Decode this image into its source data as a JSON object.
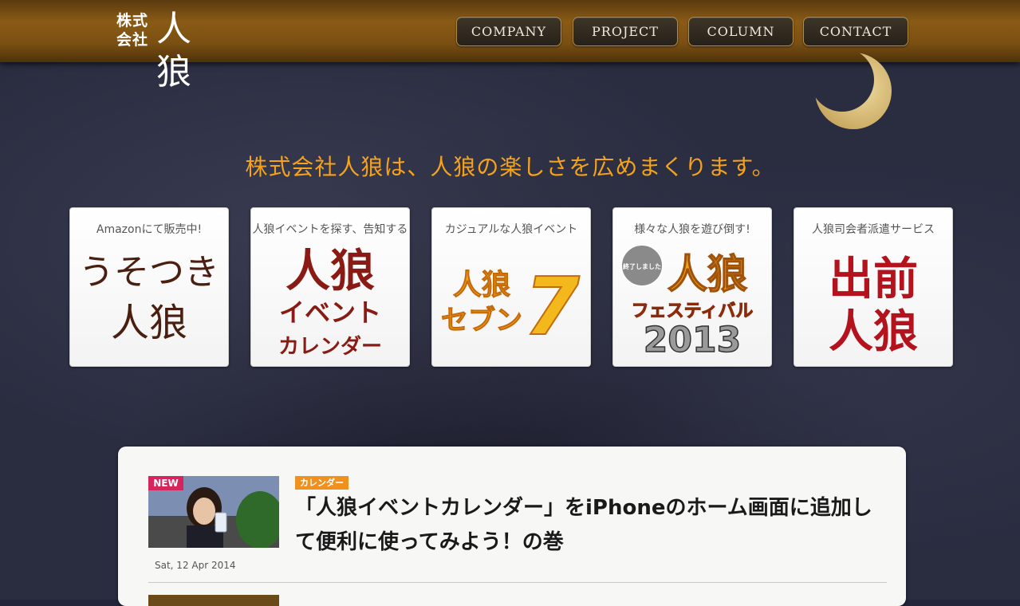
{
  "header": {
    "logo_kabu": "株式会社",
    "logo_jinrou": "人狼",
    "nav": [
      {
        "label": "COMPANY"
      },
      {
        "label": "PROJECT"
      },
      {
        "label": "COLUMN"
      },
      {
        "label": "CONTACT"
      }
    ]
  },
  "tagline": "株式会社人狼は、人狼の楽しさを広めまくります。",
  "tiles": [
    {
      "caption": "Amazonにて販売中!",
      "art_lines": [
        "うそつき",
        "人狼"
      ]
    },
    {
      "caption": "人狼イベントを探す、告知する",
      "art_lines": [
        "人狼",
        "イベント",
        "カレンダー"
      ]
    },
    {
      "caption": "カジュアルな人狼イベント",
      "art_lines": [
        "人狼",
        "セブン",
        "7"
      ]
    },
    {
      "caption": "様々な人狼を遊び倒す!",
      "art_lines": [
        "終了しました",
        "人狼",
        "フェスティバル",
        "2013"
      ]
    },
    {
      "caption": "人狼司会者派遣サービス",
      "art_lines": [
        "出前",
        "人狼"
      ]
    }
  ],
  "colors": {
    "accent": "#f5a21c",
    "new_badge": "#d6245c",
    "category": "#f0901e"
  },
  "news": {
    "entries": [
      {
        "badge": "NEW",
        "category": "カレンダー",
        "title": "「人狼イベントカレンダー」をiPhoneのホーム画面に追加して便利に使ってみよう！の巻",
        "date": "Sat, 12 Apr 2014"
      }
    ]
  }
}
